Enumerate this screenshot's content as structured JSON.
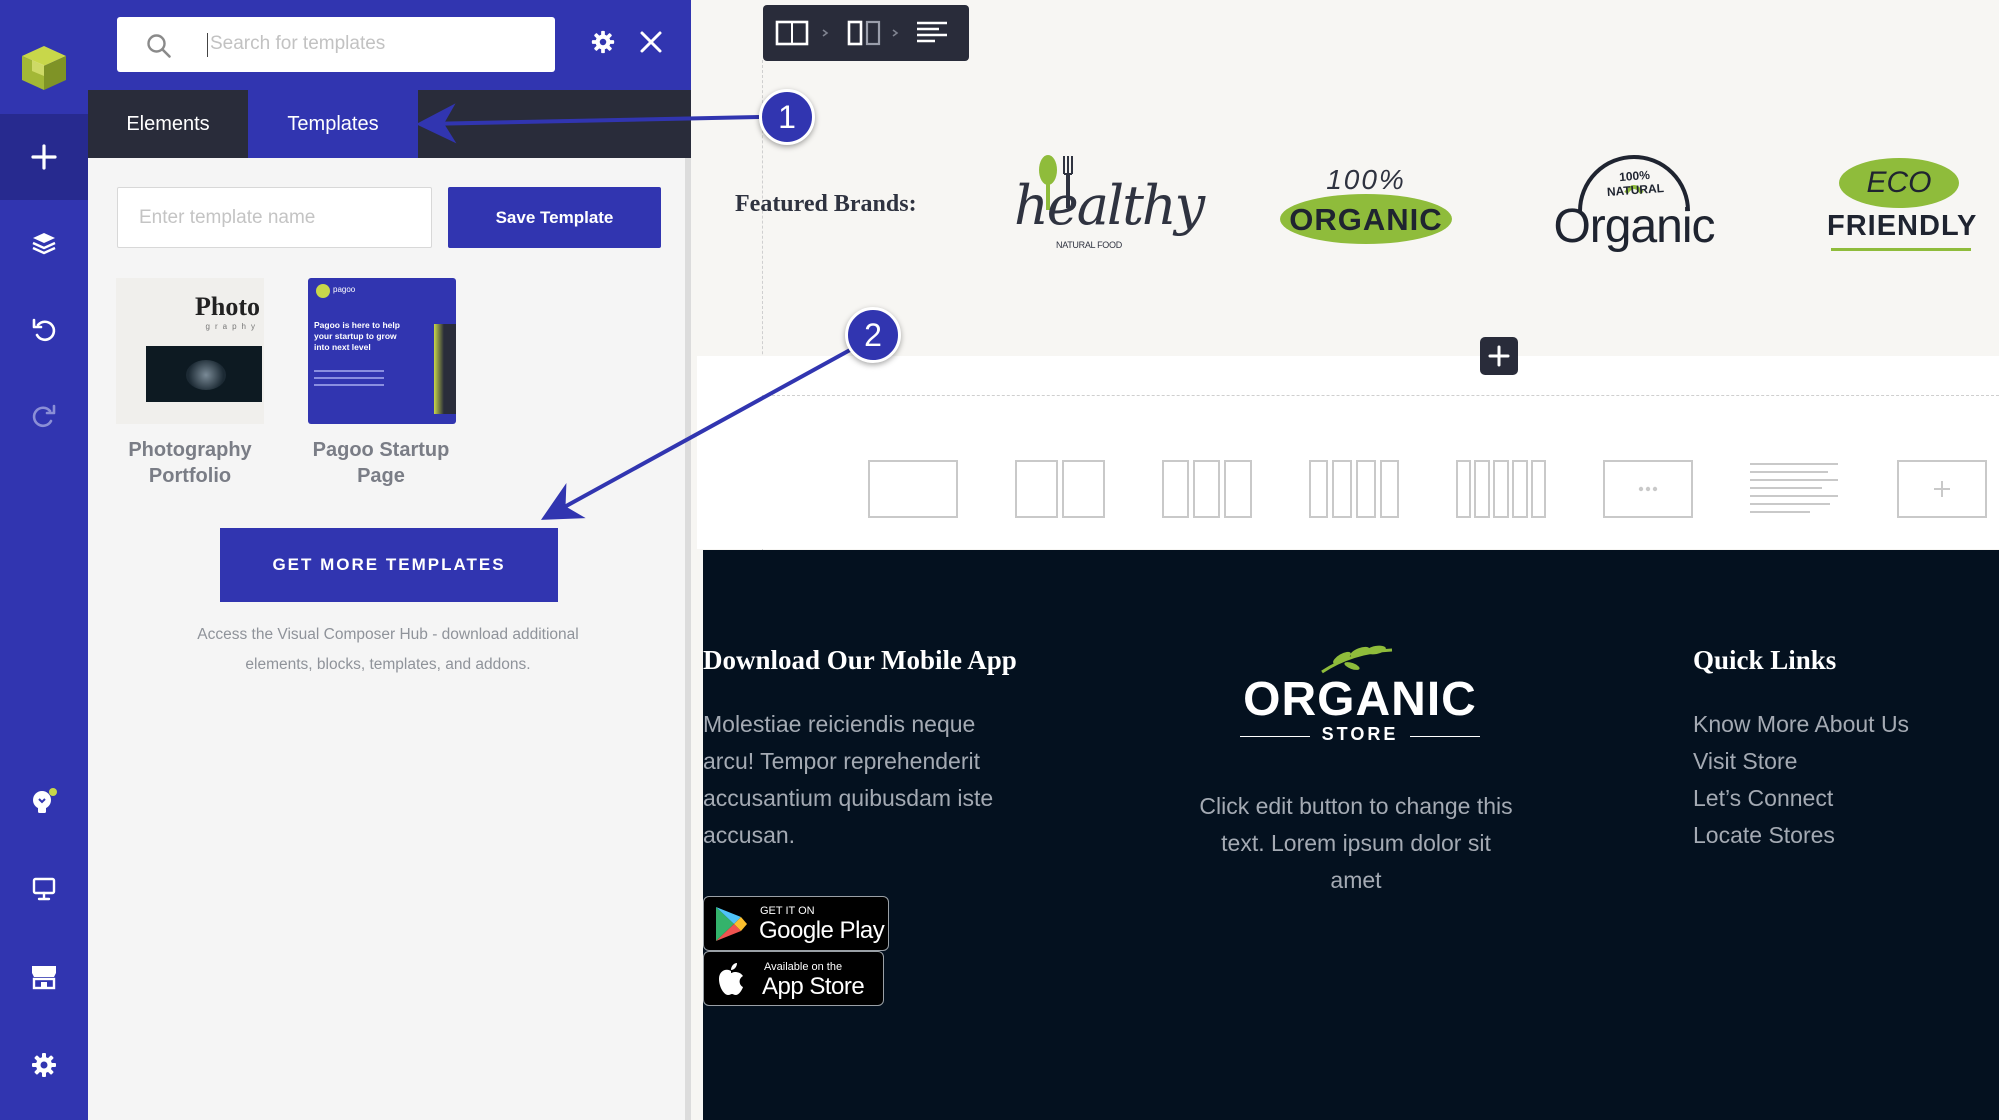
{
  "panel": {
    "search_placeholder": "Search for templates",
    "tabs": [
      {
        "label": "Elements",
        "active": false
      },
      {
        "label": "Templates",
        "active": true
      }
    ],
    "template_name_placeholder": "Enter template name",
    "save_button": "Save Template",
    "templates": [
      {
        "name": "Photography Portfolio",
        "line1": "Photography",
        "line2": "Portfolio",
        "thumb_title": "Photo",
        "thumb_sub": "graphy"
      },
      {
        "name": "Pagoo Startup Page",
        "line1": "Pagoo Startup",
        "line2": "Page",
        "thumb_logo": "pagoo",
        "thumb_text": "Pagoo is here to help your startup to grow into next level"
      }
    ],
    "get_more_button": "GET MORE TEMPLATES",
    "hub_description": "Access the Visual Composer Hub - download additional elements, blocks, templates, and addons."
  },
  "rail": {
    "icons": [
      "vc-logo-icon",
      "add-element-icon",
      "layers-icon",
      "undo-icon",
      "redo-icon",
      "hub-icon",
      "desktop-preview-icon",
      "store-icon",
      "settings-icon"
    ]
  },
  "canvas": {
    "featured_label": "Featured Brands:",
    "brands": [
      {
        "name": "healthy",
        "sub": "NATURAL FOOD"
      },
      {
        "top": "100%",
        "main": "ORGANIC"
      },
      {
        "top": "100% NATURAL",
        "main": "Organic"
      },
      {
        "top": "ECO",
        "main": "FRIENDLY"
      }
    ],
    "footer": {
      "app_title": "Download Our Mobile App",
      "app_text_lines": [
        "Molestiae reiciendis neque",
        "arcu! Tempor reprehenderit",
        "accusantium quibusdam iste",
        "accusan."
      ],
      "google_play": {
        "small": "GET IT ON",
        "big": "Google Play"
      },
      "app_store": {
        "small": "Available on the",
        "big": "App Store"
      },
      "logo": {
        "main": "ORGANIC",
        "sub": "STORE"
      },
      "center_text_lines": [
        "Click edit button to change this",
        "text. Lorem ipsum dolor sit",
        "amet"
      ],
      "links_title": "Quick Links",
      "links": [
        "Know More About Us",
        "Visit Store",
        "Let’s Connect",
        "Locate Stores"
      ]
    }
  },
  "callouts": [
    "1",
    "2"
  ],
  "colors": {
    "accent": "#3135b0",
    "dark": "#292c3a",
    "footer_bg": "#04111f",
    "brand_green": "#8fbc3b"
  }
}
